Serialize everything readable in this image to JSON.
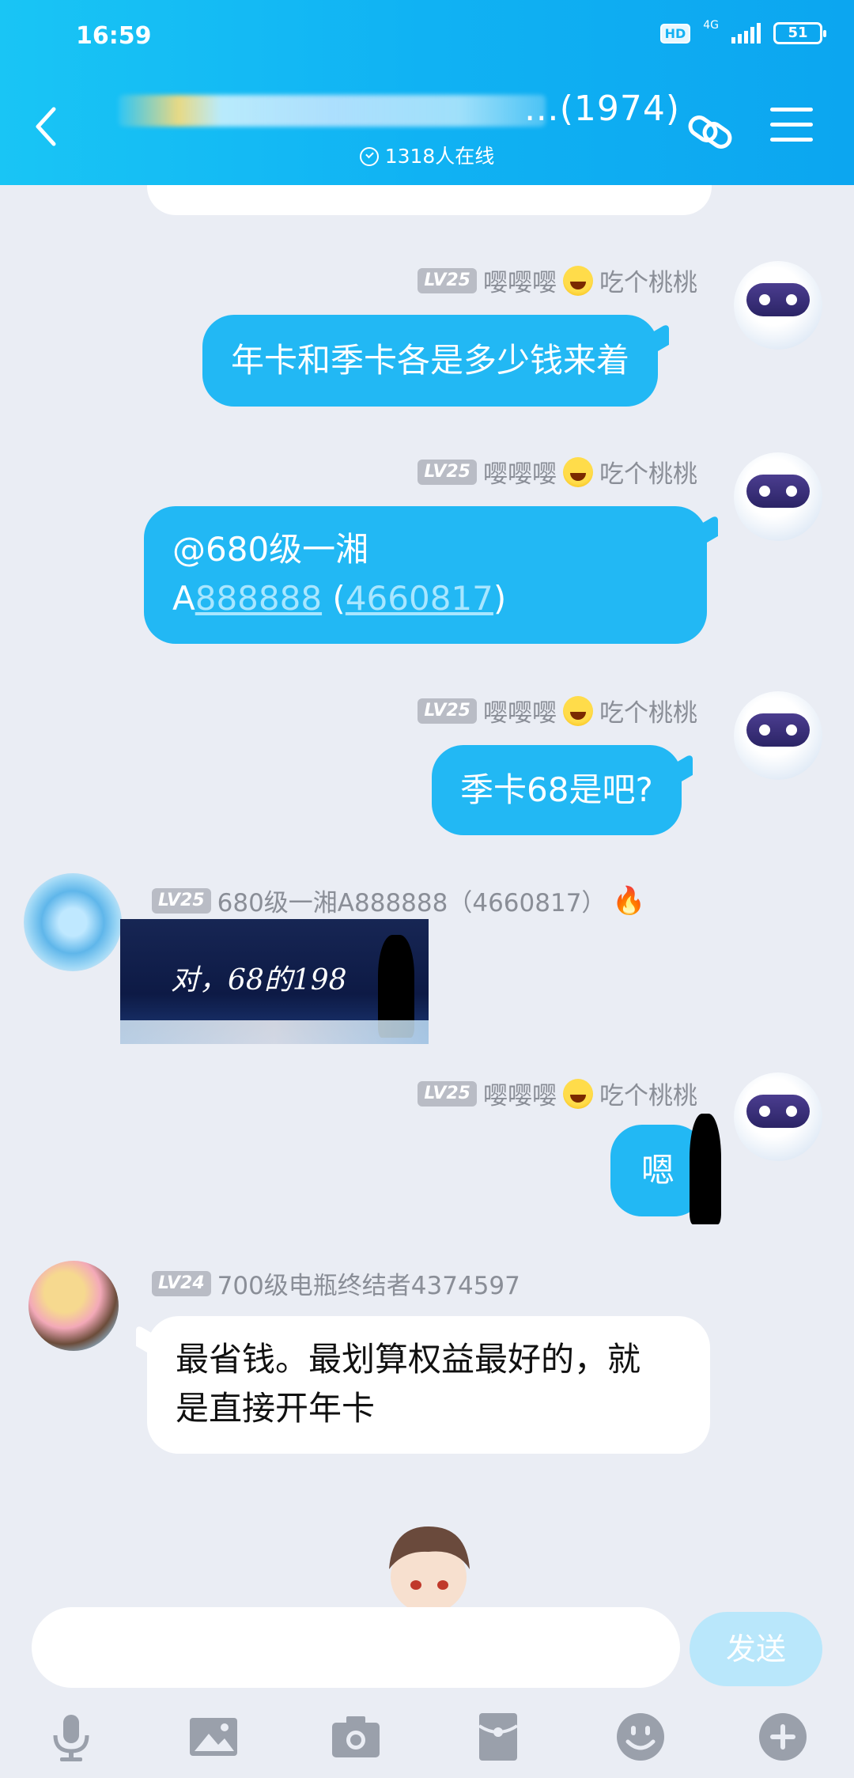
{
  "status_bar": {
    "time": "16:59",
    "hd": "HD",
    "network": "4G",
    "battery": "51"
  },
  "header": {
    "title_suffix": "…(1974)",
    "online_count": "1318人在线",
    "accent_color": "#13b1f2"
  },
  "messages": [
    {
      "id": "m1",
      "sender": "me",
      "level": "LV25",
      "name_left": "嘤嘤嘤",
      "name_right": "吃个桃桃",
      "text": "年卡和季卡各是多少钱来着"
    },
    {
      "id": "m2",
      "sender": "me",
      "level": "LV25",
      "name_left": "嘤嘤嘤",
      "name_right": "吃个桃桃",
      "line1": "@680级一湘",
      "line2_prefix": "A",
      "line2_link1": "888888",
      "line2_mid": " (",
      "line2_link2": "4660817",
      "line2_suffix": ")"
    },
    {
      "id": "m3",
      "sender": "me",
      "level": "LV25",
      "name_left": "嘤嘤嘤",
      "name_right": "吃个桃桃",
      "text": "季卡68是吧?"
    },
    {
      "id": "m4",
      "sender": "other",
      "level": "LV25",
      "name": "680级一湘A888888（4660817）",
      "sticker_text": "对，68的198"
    },
    {
      "id": "m5",
      "sender": "me",
      "level": "LV25",
      "name_left": "嘤嘤嘤",
      "name_right": "吃个桃桃",
      "text": "嗯"
    },
    {
      "id": "m6",
      "sender": "other",
      "level": "LV24",
      "name": "700级电瓶终结者4374597",
      "line1": "最省钱。最划算权益最好的，就",
      "line2": "是直接开年卡"
    }
  ],
  "input": {
    "placeholder": "",
    "send_label": "发送"
  },
  "toolbar": {
    "icons": [
      "microphone-icon",
      "image-icon",
      "camera-icon",
      "red-packet-icon",
      "emoji-icon",
      "plus-icon"
    ]
  }
}
